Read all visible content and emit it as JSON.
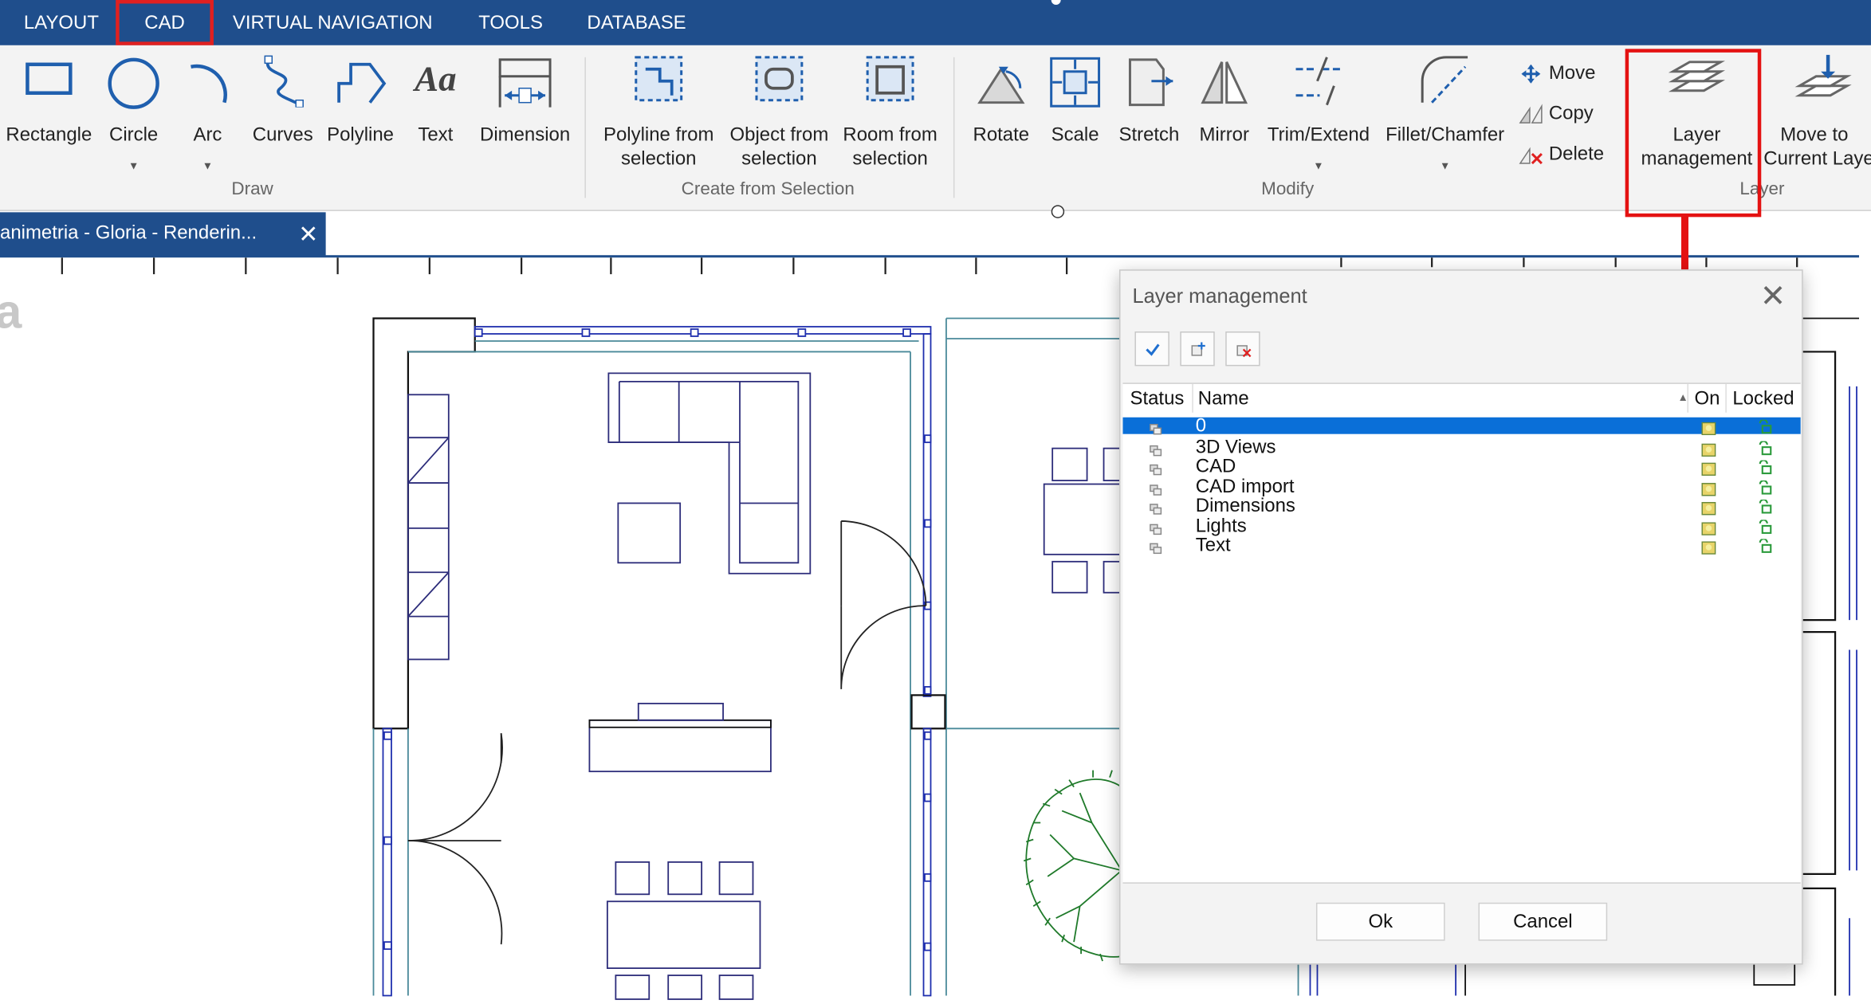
{
  "menubar": {
    "tabs": [
      "LAYOUT",
      "CAD",
      "VIRTUAL NAVIGATION",
      "TOOLS",
      "DATABASE"
    ],
    "active": "CAD"
  },
  "ribbon": {
    "draw": {
      "group": "Draw",
      "rectangle": "Rectangle",
      "circle": "Circle",
      "arc": "Arc",
      "curves": "Curves",
      "polyline": "Polyline",
      "text": "Text",
      "dimension": "Dimension"
    },
    "selection": {
      "group": "Create from Selection",
      "polyline_l1": "Polyline from",
      "polyline_l2": "selection",
      "object_l1": "Object from",
      "object_l2": "selection",
      "room_l1": "Room from",
      "room_l2": "selection"
    },
    "modify": {
      "group": "Modify",
      "rotate": "Rotate",
      "scale": "Scale",
      "stretch": "Stretch",
      "mirror": "Mirror",
      "trim": "Trim/Extend",
      "fillet": "Fillet/Chamfer",
      "move": "Move",
      "copy": "Copy",
      "delete": "Delete"
    },
    "layer": {
      "group": "Layer",
      "mgmt_l1": "Layer",
      "mgmt_l2": "management",
      "move_l1": "Move to",
      "move_l2": "Current Laye"
    },
    "icons": {
      "text_glyph": "Aa"
    }
  },
  "document": {
    "tab_title": "animetria - Gloria - Renderin...",
    "close_glyph": "✕",
    "ghost_text": "a"
  },
  "dialog": {
    "title": "Layer management",
    "close_glyph": "✕",
    "columns": {
      "status": "Status",
      "name": "Name",
      "on": "On",
      "locked": "Locked"
    },
    "layers": [
      {
        "name": "0",
        "selected": true
      },
      {
        "name": "3D Views",
        "selected": false
      },
      {
        "name": "CAD",
        "selected": false
      },
      {
        "name": "CAD import",
        "selected": false
      },
      {
        "name": "Dimensions",
        "selected": false
      },
      {
        "name": "Lights",
        "selected": false
      },
      {
        "name": "Text",
        "selected": false
      }
    ],
    "ok": "Ok",
    "cancel": "Cancel"
  },
  "colors": {
    "menubar": "#1f4e8c",
    "highlight": "#e41212",
    "selection": "#0a6fd8",
    "plan_lines": "#2c2c7a",
    "tree": "#1f7a2a"
  }
}
